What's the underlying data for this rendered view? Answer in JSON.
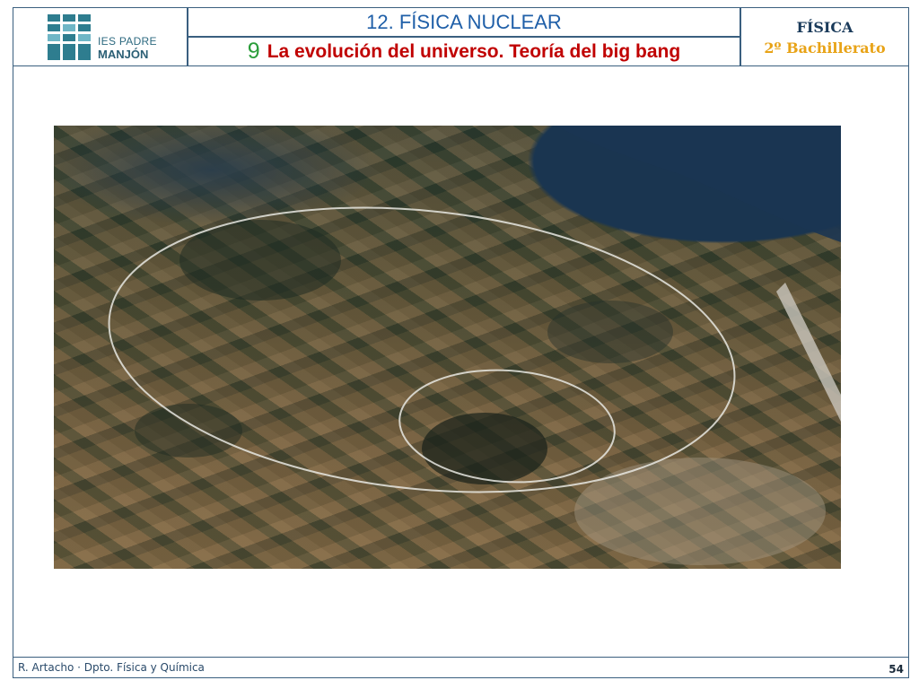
{
  "header": {
    "logo": {
      "line1": "IES PADRE",
      "line2": "MANJÓN"
    },
    "title": "12. FÍSICA NUCLEAR",
    "section_number": "9",
    "section_title": "La evolución del universo. Teoría del big bang",
    "subject": "FÍSICA",
    "course": "2º Bachillerato"
  },
  "footer": {
    "author": "R. Artacho · Dpto. Física y Química",
    "page_number": "54"
  },
  "colors": {
    "title_blue": "#1f5fa8",
    "section_red": "#c00000",
    "number_green": "#2a9d3a",
    "course_gold": "#e8a317",
    "border": "#3a5f7f"
  }
}
